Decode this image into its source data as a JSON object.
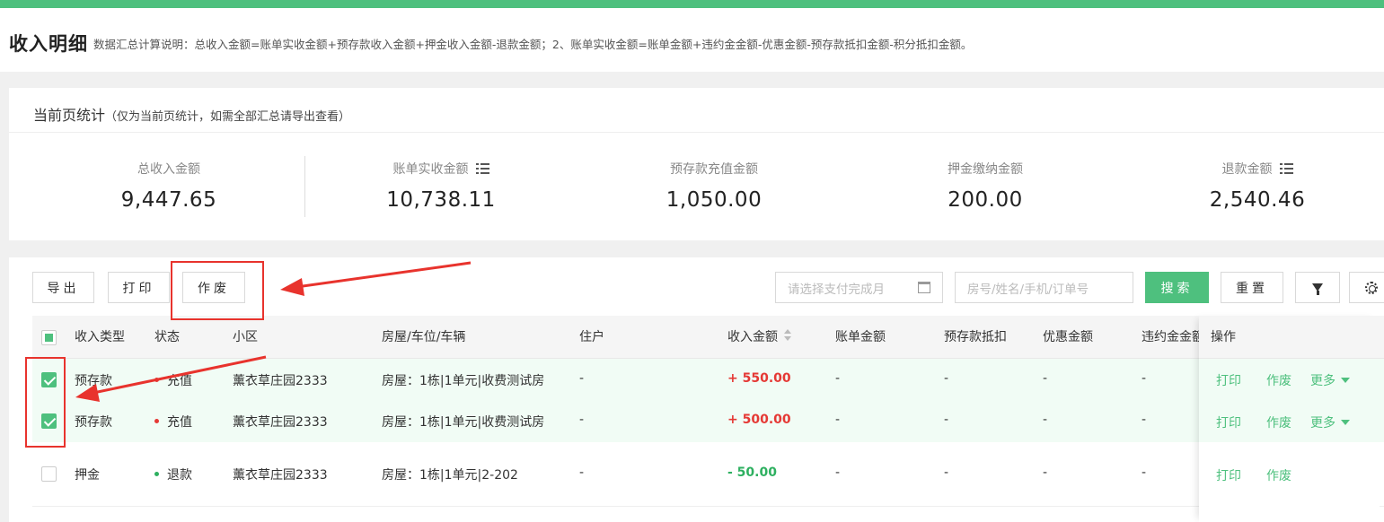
{
  "header": {
    "title": "收入明细",
    "description": "数据汇总计算说明：总收入金额=账单实收金额+预存款收入金额+押金收入金额-退款金额；2、账单实收金额=账单金额+违约金金额-优惠金额-预存款抵扣金额-积分抵扣金额。"
  },
  "stats": {
    "title": "当前页统计",
    "subtitle": "（仅为当前页统计，如需全部汇总请导出查看）",
    "items": [
      {
        "label": "总收入金额",
        "value": "9,447.65",
        "icon": null
      },
      {
        "label": "账单实收金额",
        "value": "10,738.11",
        "icon": "list-icon"
      },
      {
        "label": "预存款充值金额",
        "value": "1,050.00",
        "icon": null
      },
      {
        "label": "押金缴纳金额",
        "value": "200.00",
        "icon": null
      },
      {
        "label": "退款金额",
        "value": "2,540.46",
        "icon": "list-icon"
      }
    ]
  },
  "toolbar": {
    "export_label": "导出",
    "print_label": "打印",
    "void_label": "作废",
    "date_placeholder": "请选择支付完成月",
    "keyword_placeholder": "房号/姓名/手机/订单号",
    "search_label": "搜索",
    "reset_label": "重置"
  },
  "table": {
    "columns": [
      "收入类型",
      "状态",
      "小区",
      "房屋/车位/车辆",
      "住户",
      "收入金额",
      "账单金额",
      "预存款抵扣",
      "优惠金额",
      "违约金金额",
      "操作"
    ],
    "rows": [
      {
        "type": "预存款",
        "status": "充值",
        "status_color": "#e53935",
        "community": "薰衣草庄园2333",
        "house": "房屋：1栋|1单元|收费测试房",
        "resident": "-",
        "amount": "+ 550.00",
        "bill": "-",
        "deduct": "-",
        "discount": "-",
        "penalty": "-",
        "checked": true,
        "ops": [
          "打印",
          "作废",
          "更多"
        ]
      },
      {
        "type": "预存款",
        "status": "充值",
        "status_color": "#e53935",
        "community": "薰衣草庄园2333",
        "house": "房屋：1栋|1单元|收费测试房",
        "resident": "-",
        "amount": "+ 500.00",
        "bill": "-",
        "deduct": "-",
        "discount": "-",
        "penalty": "-",
        "checked": true,
        "ops": [
          "打印",
          "作废",
          "更多"
        ]
      },
      {
        "type": "押金",
        "status": "退款",
        "status_color": "#2eb060",
        "community": "薰衣草庄园2333",
        "house": "房屋：1栋|1单元|2-202",
        "resident": "-",
        "amount": "- 50.00",
        "bill": "-",
        "deduct": "-",
        "discount": "-",
        "penalty": "-",
        "checked": false,
        "ops": [
          "打印",
          "作废"
        ]
      }
    ]
  },
  "colors": {
    "accent": "#4ec07e",
    "positive_amount": "#e53935",
    "negative_amount": "#2eb060",
    "annotation": "#e8332d"
  }
}
